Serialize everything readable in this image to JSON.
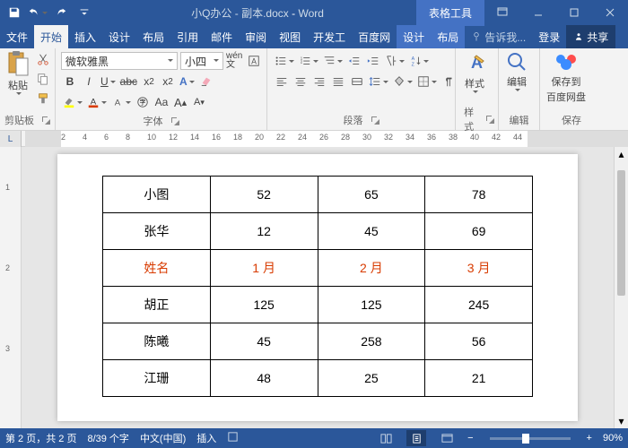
{
  "title": {
    "doc": "小Q办公 - 副本.docx",
    "app": "Word",
    "context": "表格工具"
  },
  "tabs": {
    "file": "文件",
    "home": "开始",
    "insert": "插入",
    "design": "设计",
    "layout": "布局",
    "references": "引用",
    "mailings": "邮件",
    "review": "审阅",
    "view": "视图",
    "dev": "开发工",
    "baidu": "百度网",
    "tdesign": "设计",
    "tlayout": "布局",
    "tell": "告诉我...",
    "login": "登录",
    "share": "共享"
  },
  "ribbon": {
    "clipboard": {
      "label": "剪贴板",
      "paste": "粘贴"
    },
    "font": {
      "label": "字体",
      "name": "微软雅黑",
      "size": "小四"
    },
    "paragraph": {
      "label": "段落"
    },
    "styles": {
      "label": "样式",
      "btn": "样式"
    },
    "editing": {
      "label": "编辑",
      "btn": "编辑"
    },
    "save": {
      "label": "保存",
      "btn1": "保存到",
      "btn2": "百度网盘"
    }
  },
  "ruler": {
    "corner": "L",
    "h": [
      2,
      4,
      6,
      8,
      10,
      12,
      14,
      16,
      18,
      20,
      22,
      24,
      26,
      28,
      30,
      32,
      34,
      36,
      38,
      40,
      42,
      44
    ],
    "v": [
      1,
      2,
      3
    ]
  },
  "table": {
    "rows": [
      {
        "hl": false,
        "c": [
          "小图",
          "52",
          "65",
          "78"
        ]
      },
      {
        "hl": false,
        "c": [
          "张华",
          "12",
          "45",
          "69"
        ]
      },
      {
        "hl": true,
        "c": [
          "姓名",
          "1 月",
          "2 月",
          "3 月"
        ]
      },
      {
        "hl": false,
        "c": [
          "胡正",
          "125",
          "125",
          "245"
        ]
      },
      {
        "hl": false,
        "c": [
          "陈曦",
          "45",
          "258",
          "56"
        ]
      },
      {
        "hl": false,
        "c": [
          "江珊",
          "48",
          "25",
          "21"
        ]
      }
    ]
  },
  "status": {
    "page": "第 2 页，共 2 页",
    "words": "8/39 个字",
    "lang": "中文(中国)",
    "ime": "插入",
    "zoom": "90%"
  }
}
